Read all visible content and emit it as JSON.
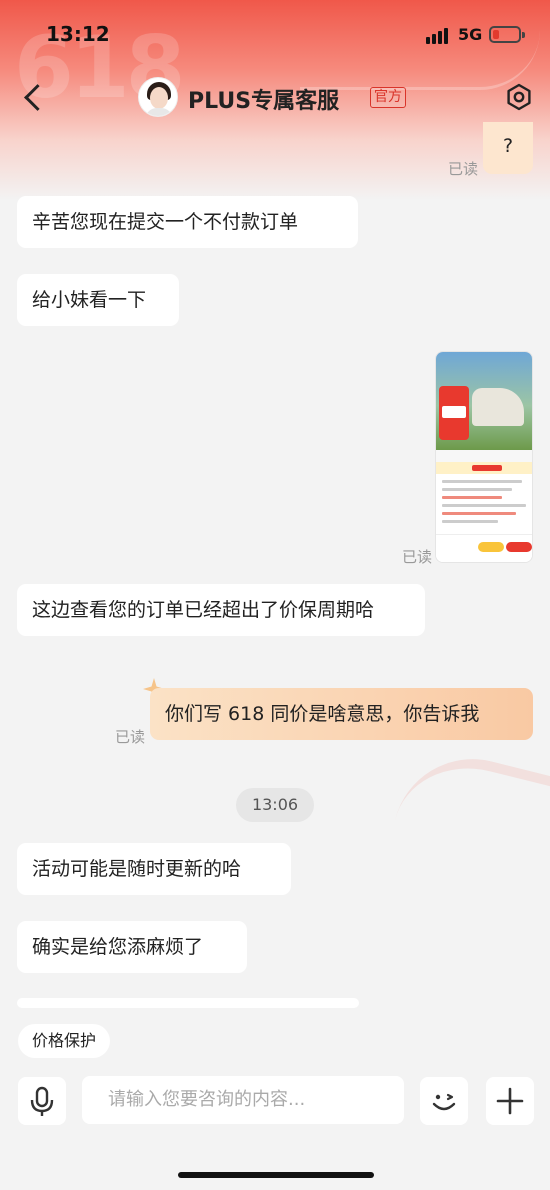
{
  "status_bar": {
    "time": "13:12",
    "network": "5G"
  },
  "header": {
    "title": "PLUS专属客服",
    "badge": "官方",
    "bg_watermark": "618"
  },
  "messages": [
    {
      "from": "me",
      "text": "?",
      "read": "已读"
    },
    {
      "from": "agent",
      "text": "辛苦您现在提交一个不付款订单"
    },
    {
      "from": "agent",
      "text": "给小妹看一下"
    },
    {
      "from": "me",
      "type": "image",
      "read": "已读"
    },
    {
      "from": "agent",
      "text": "这边查看您的订单已经超出了价保周期哈"
    },
    {
      "from": "me",
      "text": "你们写 618 同价是啥意思，你告诉我",
      "read": "已读"
    },
    {
      "type": "timestamp",
      "text": "13:06"
    },
    {
      "from": "agent",
      "text": "活动可能是随时更新的哈"
    },
    {
      "from": "agent",
      "text": "确实是给您添麻烦了"
    }
  ],
  "quick_reply": {
    "label": "价格保护"
  },
  "composer": {
    "placeholder": "请输入您要咨询的内容...",
    "icons": [
      "microphone-icon",
      "emoji-icon",
      "plus-icon"
    ]
  },
  "colors": {
    "accent": "#d9342a",
    "header_gradient_top": "#f0584a",
    "my_bubble": "#fde6cf"
  }
}
